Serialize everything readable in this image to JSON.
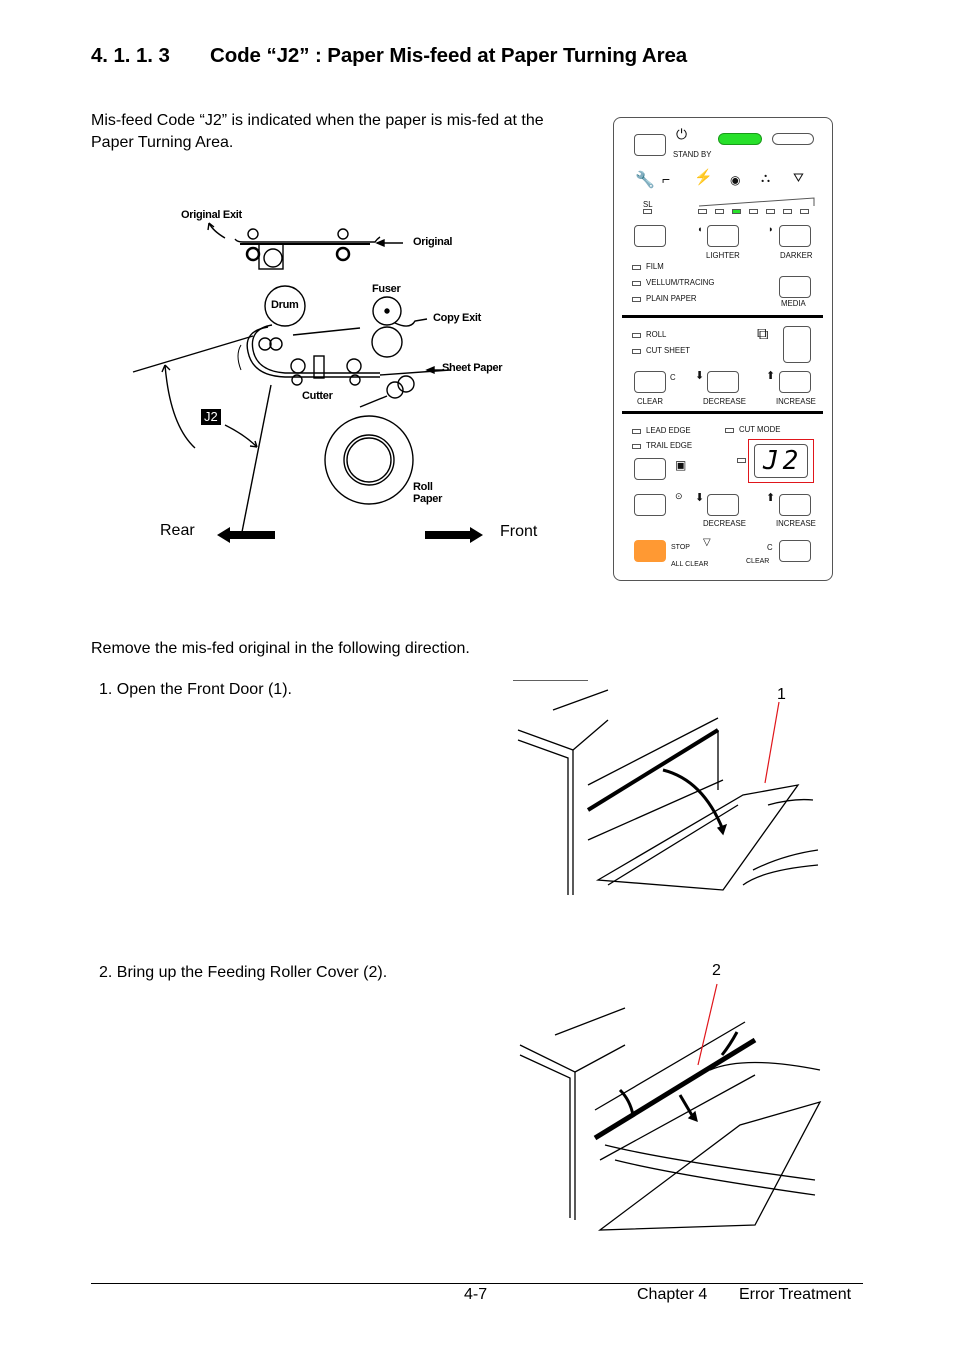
{
  "heading": {
    "number": "4. 1. 1. 3",
    "title": "Code “J2” : Paper Mis-feed at Paper Turning Area"
  },
  "intro": {
    "line1": "Mis-feed Code “J2” is indicated when the paper is mis-fed at the",
    "line2": "Paper Turning Area."
  },
  "diagram": {
    "labels": {
      "original_exit": "Original Exit",
      "original": "Original",
      "drum": "Drum",
      "fuser": "Fuser",
      "copy_exit": "Copy Exit",
      "sheet_paper": "Sheet Paper",
      "cutter": "Cutter",
      "roll_paper_1": "Roll",
      "roll_paper_2": "Paper",
      "code_badge": "J2"
    },
    "direction": {
      "rear": "Rear",
      "front": "Front"
    }
  },
  "panel": {
    "standby_label": "STAND BY",
    "sl_label": "SL",
    "density_leds_total": 7,
    "density_led_active": 3,
    "lighter_label": "LIGHTER",
    "darker_label": "DARKER",
    "media_options": [
      "FILM",
      "VELLUM/TRACING",
      "PLAIN PAPER"
    ],
    "media_label": "MEDIA",
    "feed_options": [
      "ROLL",
      "CUT SHEET"
    ],
    "clear_c": "C",
    "clear_label": "CLEAR",
    "decrease_label": "DECREASE",
    "increase_label": "INCREASE",
    "lead_edge_label": "LEAD EDGE",
    "trail_edge_label": "TRAIL EDGE",
    "cut_mode_label": "CUT MODE",
    "display_code": "J2",
    "decrease2_label": "DECREASE",
    "increase2_label": "INCREASE",
    "stop_label": "STOP",
    "all_clear_label": "ALL CLEAR",
    "clear2_c": "C",
    "clear2_label": "CLEAR",
    "colors": {
      "standby_led": "#27e02a",
      "stop_button": "#ff9933",
      "highlight": "#e0161b"
    }
  },
  "instructions": {
    "lead": "Remove the mis-fed original in the following direction.",
    "steps": [
      {
        "text": "1.  Open the Front Door (1).",
        "callout": "1"
      },
      {
        "text": "2.  Bring up the Feeding Roller Cover (2).",
        "callout": "2"
      }
    ]
  },
  "footer": {
    "page": "4-7",
    "chapter": "Chapter 4",
    "section": "Error Treatment"
  }
}
